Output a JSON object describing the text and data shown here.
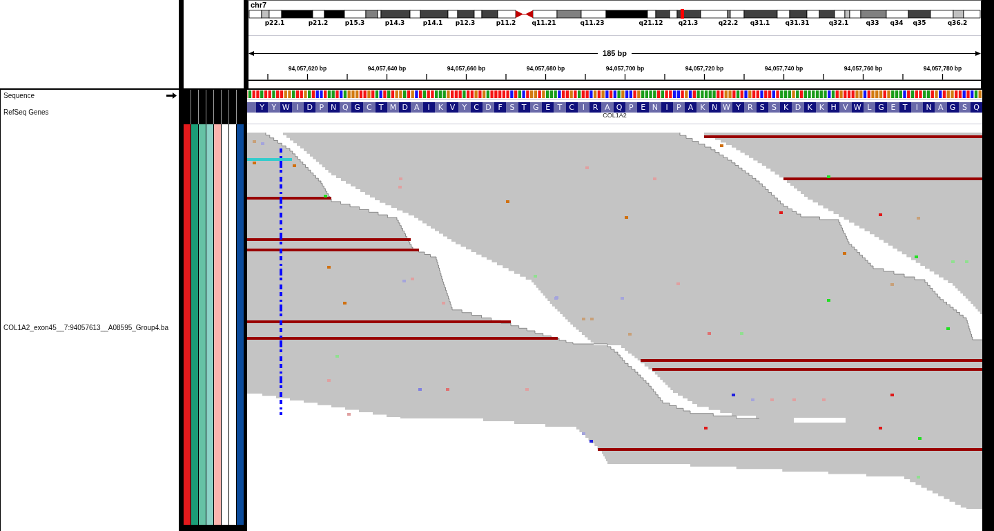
{
  "ideogram": {
    "chromosome": "chr7",
    "band_labels": [
      "p22.1",
      "p21.2",
      "p15.3",
      "p14.3",
      "p14.1",
      "p12.3",
      "p11.2",
      "q11.21",
      "q11.23",
      "q21.12",
      "q21.3",
      "q22.2",
      "q31.1",
      "q31.31",
      "q32.1",
      "q33",
      "q34",
      "q35",
      "q36.2"
    ]
  },
  "ruler": {
    "span": "185 bp",
    "ticks": [
      "94,057,620 bp",
      "94,057,640 bp",
      "94,057,660 bp",
      "94,057,680 bp",
      "94,057,700 bp",
      "94,057,720 bp",
      "94,057,740 bp",
      "94,057,760 bp",
      "94,057,780 bp"
    ]
  },
  "tracks": [
    {
      "kind": "sequence",
      "name": "Sequence",
      "forward_strand": true
    },
    {
      "kind": "gene",
      "name": "RefSeq Genes",
      "gene": "COL1A2",
      "amino_acids": [
        "Y",
        "Y",
        "W",
        "I",
        "D",
        "P",
        "N",
        "Q",
        "G",
        "C",
        "T",
        "M",
        "D",
        "A",
        "I",
        "K",
        "V",
        "Y",
        "C",
        "D",
        "F",
        "S",
        "T",
        "G",
        "E",
        "T",
        "C",
        "I",
        "R",
        "A",
        "Q",
        "P",
        "E",
        "N",
        "I",
        "P",
        "A",
        "K",
        "N",
        "W",
        "Y",
        "R",
        "S",
        "S",
        "K",
        "D",
        "K",
        "K",
        "H",
        "V",
        "W",
        "L",
        "G",
        "E",
        "T",
        "I",
        "N",
        "A",
        "G",
        "S",
        "Q"
      ]
    },
    {
      "kind": "alignment",
      "name": "COL1A2_exon45__7:94057613__A08595_Group4.ba",
      "attributes": [
        {
          "color": "#e31a1c"
        },
        {
          "color": "#1b9e77"
        },
        {
          "color": "#66c2a5"
        },
        {
          "color": "#8dd3c7"
        },
        {
          "color": "#fbb4ae"
        },
        {
          "color": "#ffffff"
        },
        {
          "color": "#ffffff"
        },
        {
          "color": "#0b4b9b"
        }
      ]
    }
  ]
}
